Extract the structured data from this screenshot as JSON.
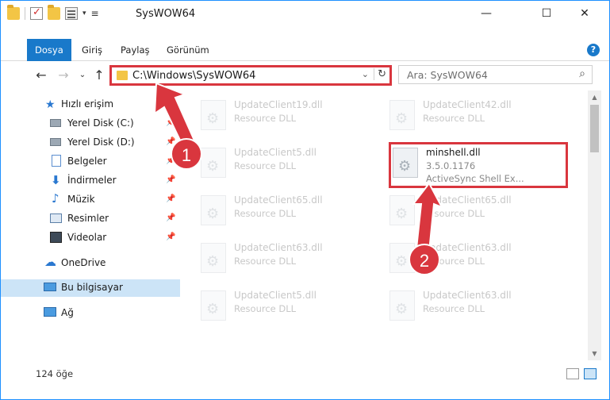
{
  "window": {
    "title": "SysWOW64"
  },
  "ribbon": {
    "tabs": [
      "Dosya",
      "Giriş",
      "Paylaş",
      "Görünüm"
    ]
  },
  "address": {
    "path": "C:\\Windows\\SysWOW64"
  },
  "search": {
    "placeholder": "Ara: SysWOW64"
  },
  "sidebar": {
    "items": [
      {
        "label": "Hızlı erişim"
      },
      {
        "label": "Yerel Disk (C:)"
      },
      {
        "label": "Yerel Disk (D:)"
      },
      {
        "label": "Belgeler"
      },
      {
        "label": "İndirmeler"
      },
      {
        "label": "Müzik"
      },
      {
        "label": "Resimler"
      },
      {
        "label": "Videolar"
      },
      {
        "label": "OneDrive"
      },
      {
        "label": "Bu bilgisayar"
      },
      {
        "label": "Ağ"
      }
    ]
  },
  "files": [
    {
      "name": "UpdateClient19.dll",
      "sub": "Resource DLL"
    },
    {
      "name": "UpdateClient42.dll",
      "sub": "Resource DLL"
    },
    {
      "name": "UpdateClient5.dll",
      "sub": "Resource DLL"
    },
    {
      "name": "minshell.dll",
      "version": "3.5.0.1176",
      "desc": "ActiveSync Shell Ex..."
    },
    {
      "name": "UpdateClient65.dll",
      "sub": "Resource DLL"
    },
    {
      "name": "UpdateClient65.dll",
      "sub": "Resource DLL"
    },
    {
      "name": "UpdateClient63.dll",
      "sub": "Resource DLL"
    },
    {
      "name": "UpdateClient63.dll",
      "sub": "Resource DLL"
    },
    {
      "name": "UpdateClient5.dll",
      "sub": "Resource DLL"
    },
    {
      "name": "UpdateClient63.dll",
      "sub": "Resource DLL"
    }
  ],
  "status": {
    "count": "124 öğe"
  },
  "annotations": {
    "step1": "1",
    "step2": "2"
  },
  "colors": {
    "accent": "#1979ca",
    "annotation": "#d9363e",
    "selection": "#cce4f7"
  }
}
